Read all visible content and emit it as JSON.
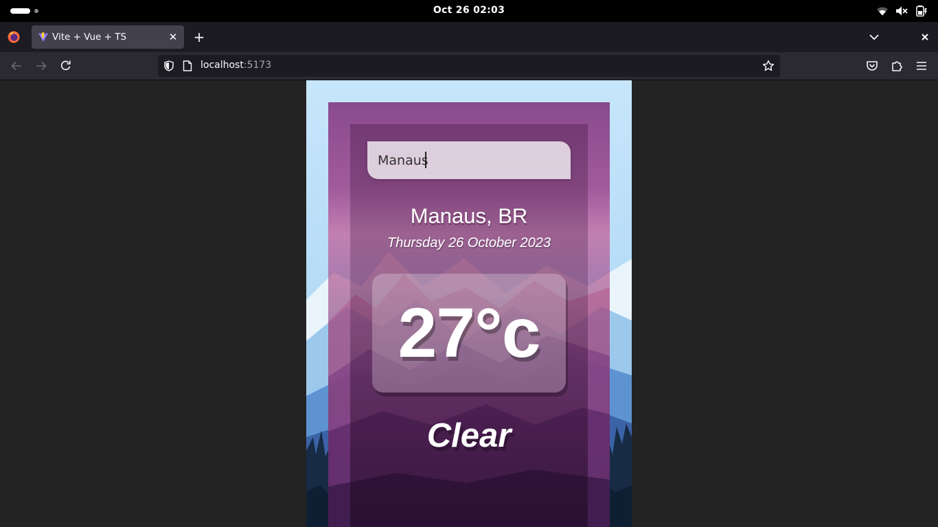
{
  "system": {
    "clock": "Oct 26  02:03",
    "icons": [
      "wifi-icon",
      "volume-muted-icon",
      "battery-icon"
    ]
  },
  "browser": {
    "tab": {
      "title": "Vite + Vue + TS",
      "favicon": "vite-icon"
    },
    "url": {
      "host": "localhost",
      "port": ":5173"
    },
    "colors": {
      "chrome": "#1c1b22",
      "toolbar": "#2b2a33",
      "tab_active": "#42414d",
      "text": "#fbfbfe"
    }
  },
  "app": {
    "search": {
      "value": "Manaus",
      "placeholder": ""
    },
    "location": "Manaus, BR",
    "date": "Thursday 26 October 2023",
    "temperature": "27°c",
    "weather": "Clear"
  }
}
